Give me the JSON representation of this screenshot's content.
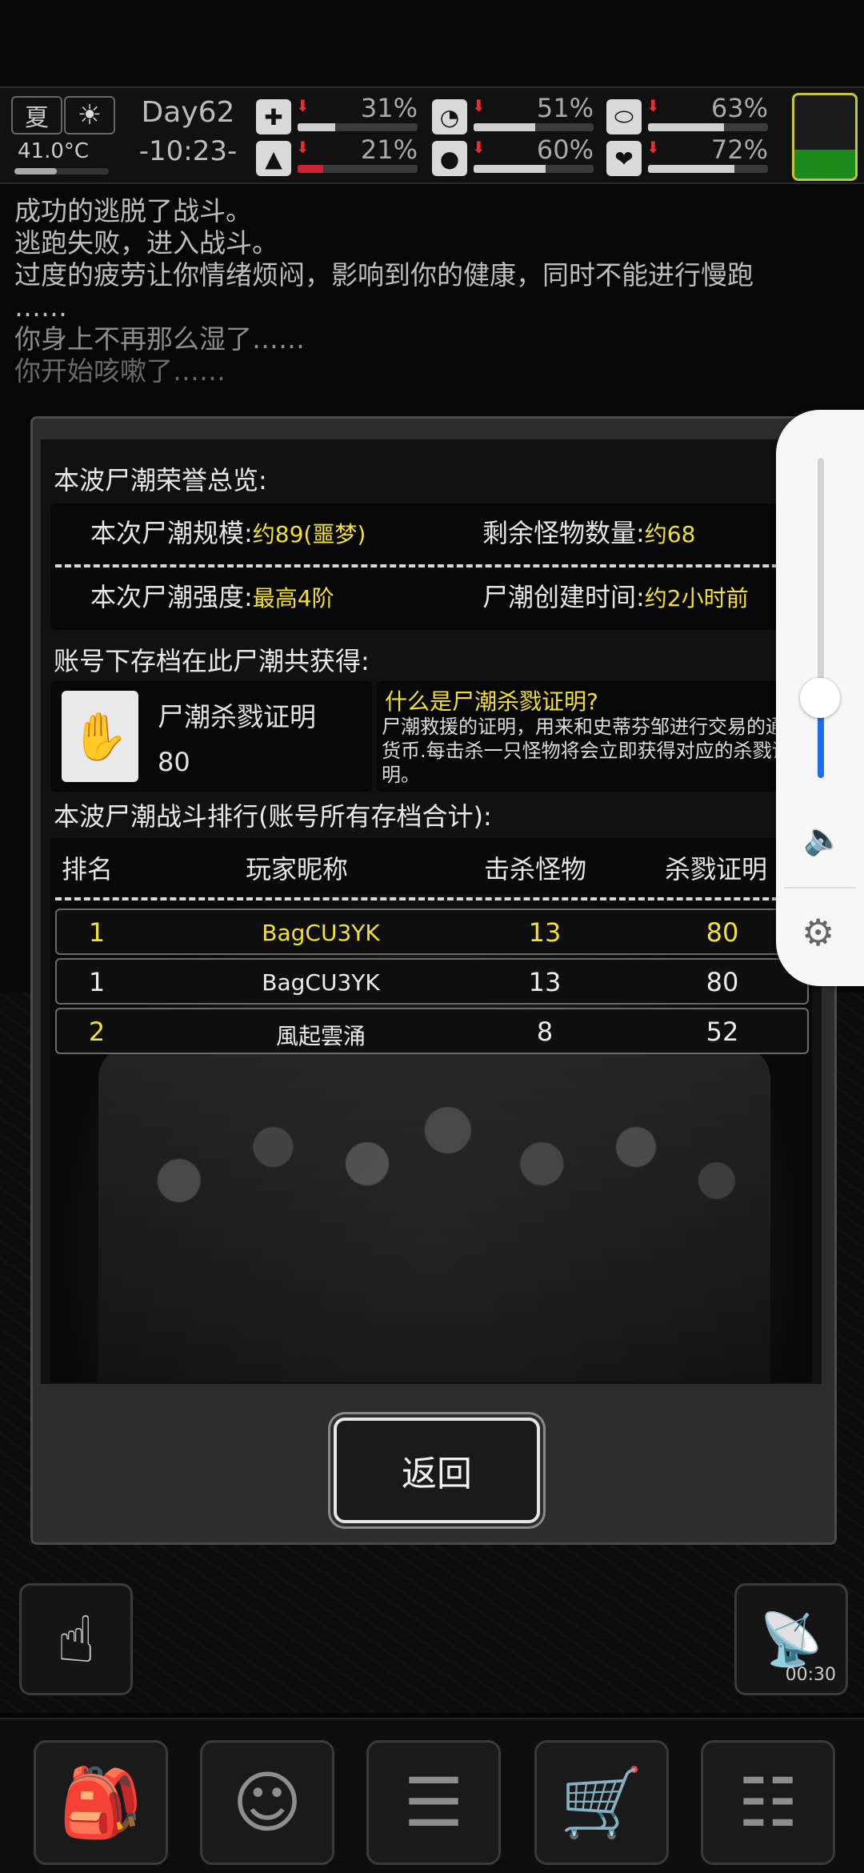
{
  "status": {
    "season": "夏",
    "temperature": "41.0°C",
    "day": "Day62",
    "time": "-10:23-",
    "stats": [
      {
        "name": "health",
        "icon": "medkit-icon",
        "glyph": "✚",
        "value": "31%",
        "fill": 31
      },
      {
        "name": "hunger",
        "icon": "stomach-icon",
        "glyph": "◔",
        "value": "51%",
        "fill": 51
      },
      {
        "name": "medicine",
        "icon": "pill-icon",
        "glyph": "⬭",
        "value": "63%",
        "fill": 63
      },
      {
        "name": "stamina",
        "icon": "boot-icon",
        "glyph": "▲",
        "value": "21%",
        "fill": 21
      },
      {
        "name": "thirst",
        "icon": "water-drop-icon",
        "glyph": "●",
        "value": "60%",
        "fill": 60
      },
      {
        "name": "mood",
        "icon": "heart-icon",
        "glyph": "❤",
        "value": "72%",
        "fill": 72
      }
    ]
  },
  "log": [
    "成功的逃脱了战斗。",
    "逃跑失败，进入战斗。",
    "过度的疲劳让你情绪烦闷，影响到你的健康，同时不能进行慢跑",
    "……",
    "你身上不再那么湿了……",
    "你开始咳嗽了……"
  ],
  "modal": {
    "overview_title": "本波尸潮荣誉总览:",
    "scale_label": "本次尸潮规模:",
    "scale_value": "约89(噩梦)",
    "remaining_label": "剩余怪物数量:",
    "remaining_value": "约68",
    "intensity_label": "本次尸潮强度:",
    "intensity_value": "最高4阶",
    "created_label": "尸潮创建时间:",
    "created_value": "约2小时前",
    "reward_title": "账号下存档在此尸潮共获得:",
    "reward_name": "尸潮杀戮证明",
    "reward_count": "80",
    "what_title": "什么是尸潮杀戮证明?",
    "what_desc": "尸潮救援的证明，用来和史蒂芬邹进行交易的通用货币.每击杀一只怪物将会立即获得对应的杀戮证明。",
    "ranking_title": "本波尸潮战斗排行(账号所有存档合计):",
    "columns": [
      "排名",
      "玩家昵称",
      "击杀怪物",
      "杀戮证明"
    ],
    "rows": [
      {
        "rank": "1",
        "name": "BagCU3YK",
        "kills": "13",
        "proof": "80"
      },
      {
        "rank": "1",
        "name": "BagCU3YK",
        "kills": "13",
        "proof": "80"
      },
      {
        "rank": "2",
        "name": "風起雲涌",
        "kills": "8",
        "proof": "52"
      }
    ],
    "back_label": "返回"
  },
  "side": {
    "radar_timer": "00:30"
  },
  "volume": {
    "level": 25
  },
  "colors": {
    "accent_yellow": "#f3e034",
    "volume_blue": "#1a6cf0",
    "battery_green": "#1c8a1c"
  }
}
